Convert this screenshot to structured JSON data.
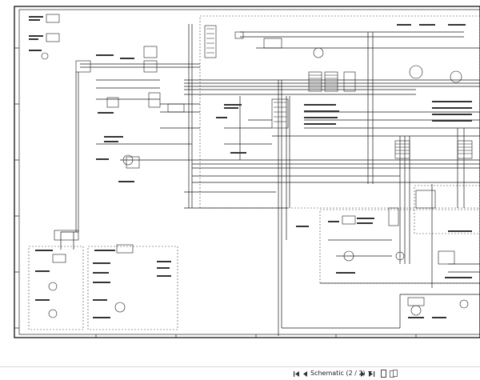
{
  "toolbar": {
    "page_label": "Schematic (2 / 2)",
    "icons": [
      "first-page-icon",
      "previous-page-icon",
      "page-dropdown-icon",
      "next-page-icon",
      "last-page-icon",
      "single-page-view-icon",
      "two-page-view-icon"
    ]
  },
  "colors": {
    "sheet_bg": "#ffffff",
    "line": "#1a1a1a",
    "border": "#000000",
    "dashed": "#444444"
  }
}
